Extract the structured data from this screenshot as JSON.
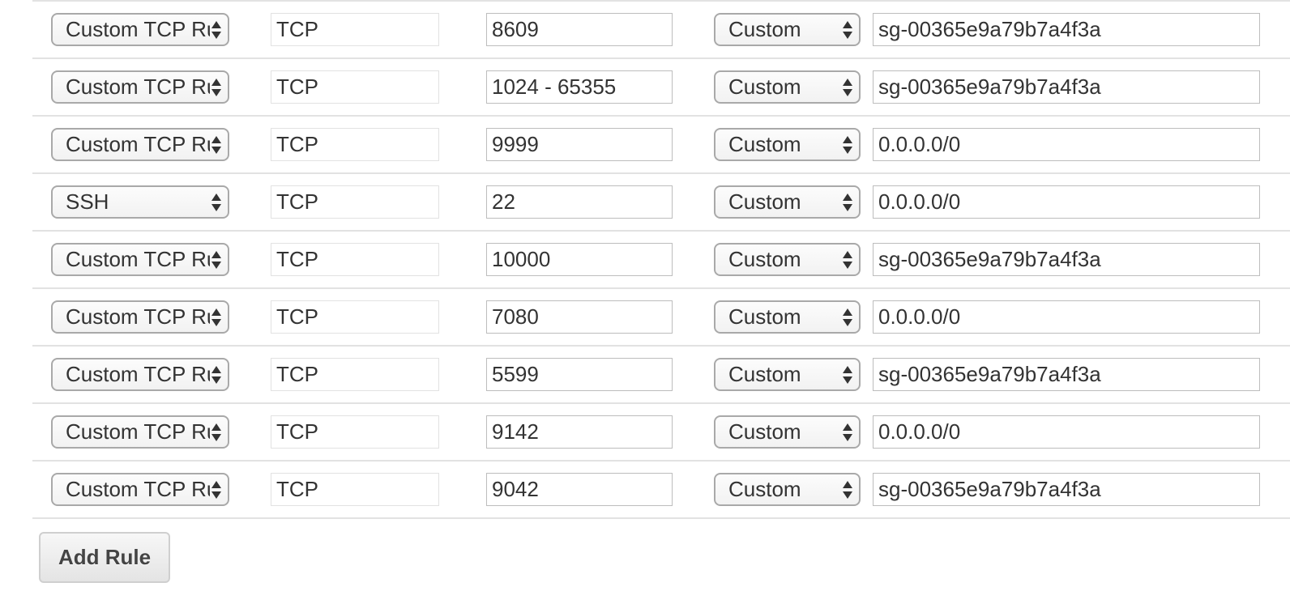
{
  "rules": [
    {
      "type": "Custom TCP Rule",
      "protocol": "TCP",
      "port": "8609",
      "source": "Custom",
      "value": "sg-00365e9a79b7a4f3a"
    },
    {
      "type": "Custom TCP Rule",
      "protocol": "TCP",
      "port": "1024 - 65355",
      "source": "Custom",
      "value": "sg-00365e9a79b7a4f3a"
    },
    {
      "type": "Custom TCP Rule",
      "protocol": "TCP",
      "port": "9999",
      "source": "Custom",
      "value": "0.0.0.0/0"
    },
    {
      "type": "SSH",
      "protocol": "TCP",
      "port": "22",
      "source": "Custom",
      "value": "0.0.0.0/0"
    },
    {
      "type": "Custom TCP Rule",
      "protocol": "TCP",
      "port": "10000",
      "source": "Custom",
      "value": "sg-00365e9a79b7a4f3a"
    },
    {
      "type": "Custom TCP Rule",
      "protocol": "TCP",
      "port": "7080",
      "source": "Custom",
      "value": "0.0.0.0/0"
    },
    {
      "type": "Custom TCP Rule",
      "protocol": "TCP",
      "port": "5599",
      "source": "Custom",
      "value": "sg-00365e9a79b7a4f3a"
    },
    {
      "type": "Custom TCP Rule",
      "protocol": "TCP",
      "port": "9142",
      "source": "Custom",
      "value": "0.0.0.0/0"
    },
    {
      "type": "Custom TCP Rule",
      "protocol": "TCP",
      "port": "9042",
      "source": "Custom",
      "value": "sg-00365e9a79b7a4f3a"
    }
  ],
  "add_rule_label": "Add Rule"
}
